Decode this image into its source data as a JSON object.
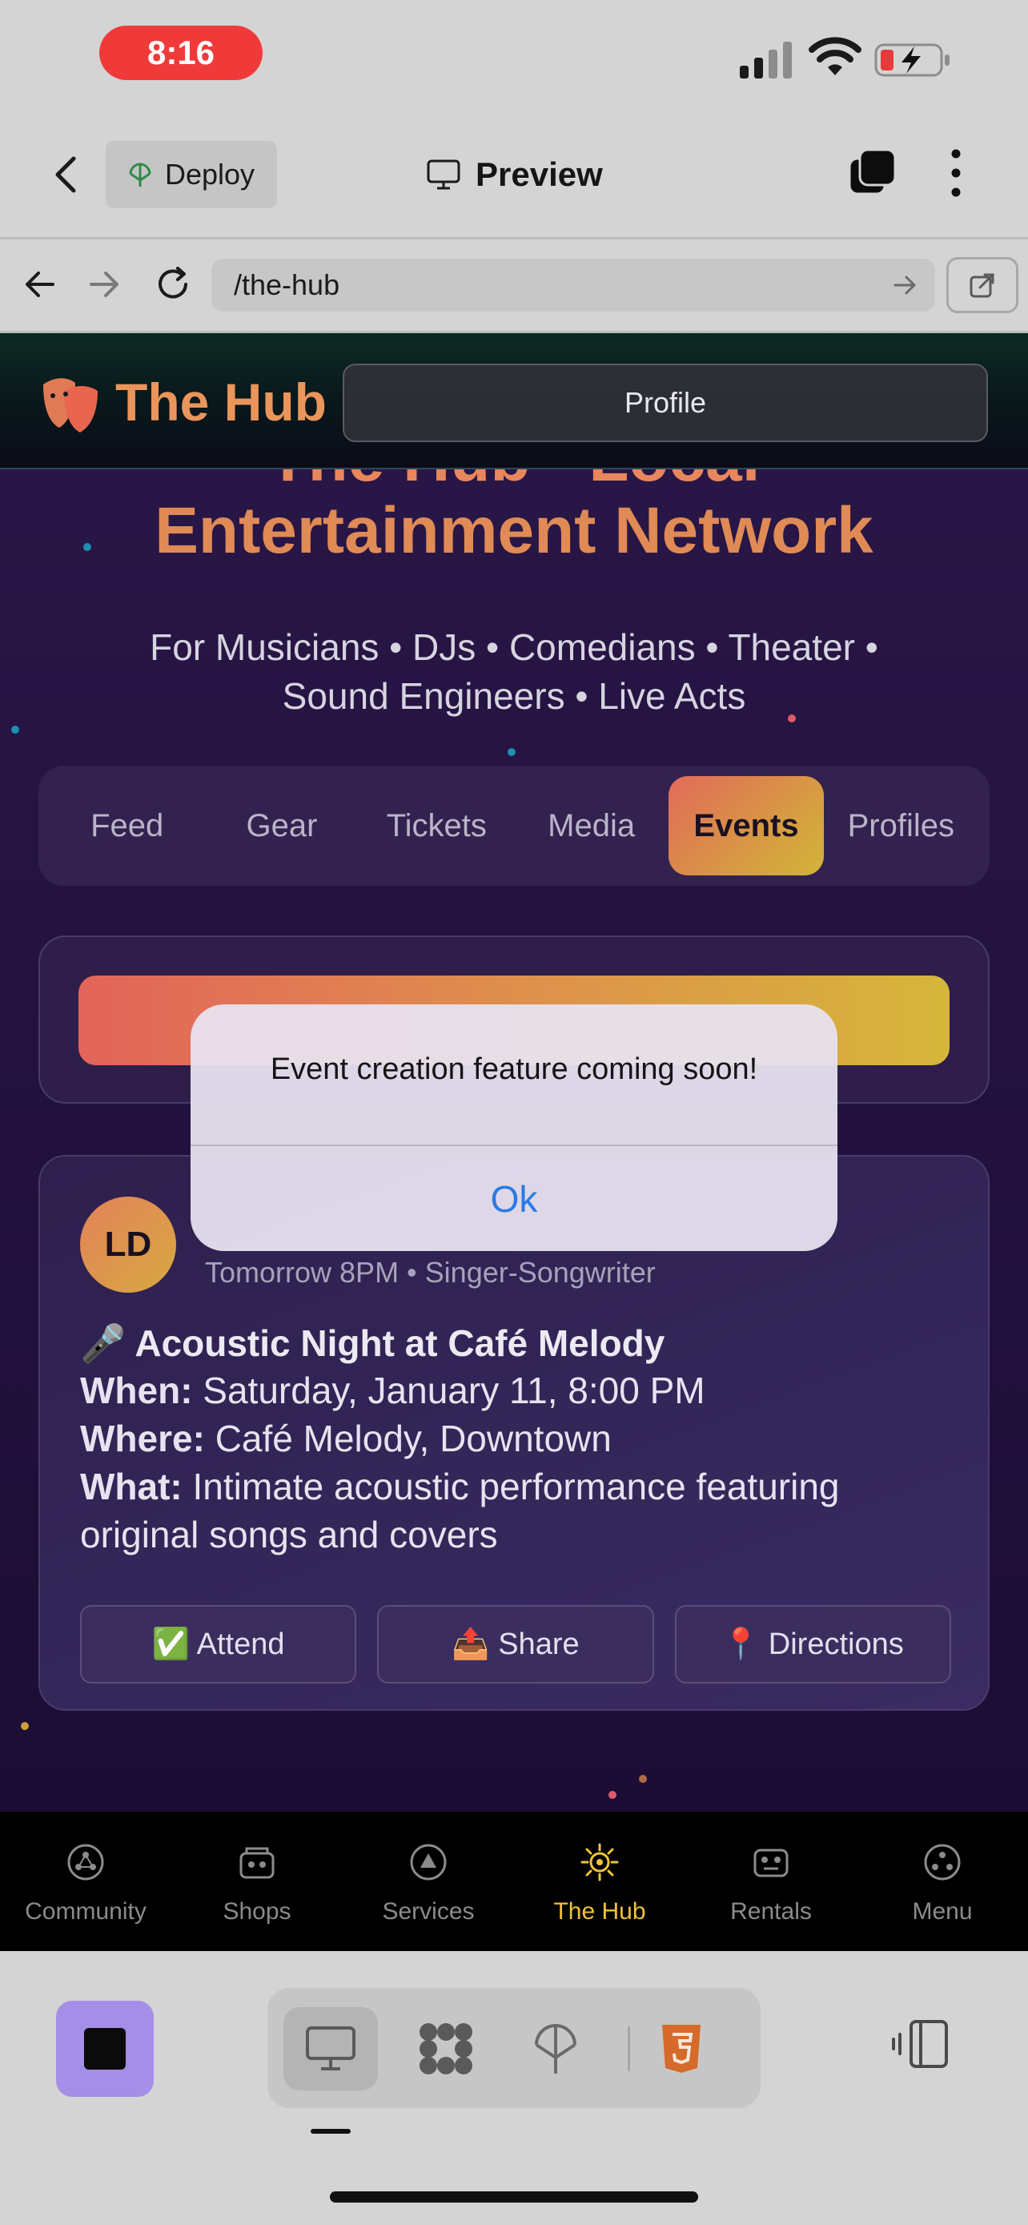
{
  "status": {
    "time": "8:16"
  },
  "toolbar": {
    "deploy_label": "Deploy",
    "preview_label": "Preview"
  },
  "address": {
    "url": "/the-hub"
  },
  "hub": {
    "brand": "The Hub",
    "profile_label": "Profile",
    "hero_line1": "The Hub - Local",
    "hero_line2": "Entertainment Network",
    "subtitle_line1": "For Musicians • DJs • Comedians • Theater •",
    "subtitle_line2": "Sound Engineers • Live Acts",
    "tabs": [
      {
        "label": "Feed"
      },
      {
        "label": "Gear"
      },
      {
        "label": "Tickets"
      },
      {
        "label": "Media"
      },
      {
        "label": "Events"
      },
      {
        "label": "Profiles"
      }
    ],
    "active_tab": "Events"
  },
  "event": {
    "avatar_initials": "LD",
    "meta": "Tomorrow 8PM • Singer-Songwriter",
    "title": "🎤 Acoustic Night at Café Melody",
    "when_label": "When:",
    "when_value": "Saturday, January 11, 8:00 PM",
    "where_label": "Where:",
    "where_value": "Café Melody, Downtown",
    "what_label": "What:",
    "what_value_line1": "Intimate acoustic performance featuring",
    "what_value_line2": "original songs and covers",
    "actions": [
      {
        "label": "✅ Attend"
      },
      {
        "label": "📤 Share"
      },
      {
        "label": "📍 Directions"
      }
    ]
  },
  "alert": {
    "message": "Event creation feature coming soon!",
    "ok_label": "Ok"
  },
  "app_tabs": [
    {
      "label": "Community",
      "icon": "community-icon"
    },
    {
      "label": "Shops",
      "icon": "shops-icon"
    },
    {
      "label": "Services",
      "icon": "services-icon"
    },
    {
      "label": "The Hub",
      "icon": "hub-icon"
    },
    {
      "label": "Rentals",
      "icon": "rentals-icon"
    },
    {
      "label": "Menu",
      "icon": "menu-icon"
    }
  ],
  "app_tabs_active": "The Hub",
  "colors": {
    "accent_orange": "#e8875b",
    "accent_gold": "#f0c23a",
    "alert_link": "#2a7be6",
    "stop_purple": "#a58ee8",
    "status_red": "#f03a3a"
  }
}
